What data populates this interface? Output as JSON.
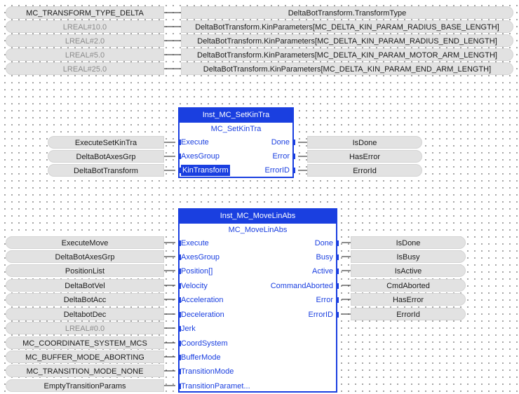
{
  "header_rows": [
    {
      "left": "MC_TRANSFORM_TYPE_DELTA",
      "right": "DeltaBotTransform.TransformType",
      "dim": false
    },
    {
      "left": "LREAL#10.0",
      "right": "DeltaBotTransform.KinParameters[MC_DELTA_KIN_PARAM_RADIUS_BASE_LENGTH]",
      "dim": true
    },
    {
      "left": "LREAL#2.0",
      "right": "DeltaBotTransform.KinParameters[MC_DELTA_KIN_PARAM_RADIUS_END_LENGTH]",
      "dim": true
    },
    {
      "left": "LREAL#5.0",
      "right": "DeltaBotTransform.KinParameters[MC_DELTA_KIN_PARAM_MOTOR_ARM_LENGTH]",
      "dim": true
    },
    {
      "left": "LREAL#25.0",
      "right": "DeltaBotTransform.KinParameters[MC_DELTA_KIN_PARAM_END_ARM_LENGTH]",
      "dim": true
    }
  ],
  "setkin": {
    "instance": "Inst_MC_SetKinTra",
    "type": "MC_SetKinTra",
    "inputs": [
      {
        "pin": "Execute",
        "var": "ExecuteSetKinTra",
        "selected": false
      },
      {
        "pin": "AxesGroup",
        "var": "DeltaBotAxesGrp",
        "selected": false
      },
      {
        "pin": "KinTransform",
        "var": "DeltaBotTransform",
        "selected": true
      }
    ],
    "outputs": [
      {
        "pin": "Done",
        "var": "IsDone"
      },
      {
        "pin": "Error",
        "var": "HasError"
      },
      {
        "pin": "ErrorID",
        "var": "ErrorId"
      }
    ]
  },
  "movelin": {
    "instance": "Inst_MC_MoveLinAbs",
    "type": "MC_MoveLinAbs",
    "inputs": [
      {
        "pin": "Execute",
        "var": "ExecuteMove",
        "dim": false
      },
      {
        "pin": "AxesGroup",
        "var": "DeltaBotAxesGrp",
        "dim": false
      },
      {
        "pin": "Position[]",
        "var": "PositionList",
        "dim": false
      },
      {
        "pin": "Velocity",
        "var": "DeltaBotVel",
        "dim": false
      },
      {
        "pin": "Acceleration",
        "var": "DeltaBotAcc",
        "dim": false
      },
      {
        "pin": "Deceleration",
        "var": "DeltabotDec",
        "dim": false
      },
      {
        "pin": "Jerk",
        "var": "LREAL#0.0",
        "dim": true
      },
      {
        "pin": "CoordSystem",
        "var": "MC_COORDINATE_SYSTEM_MCS",
        "dim": false
      },
      {
        "pin": "BufferMode",
        "var": "MC_BUFFER_MODE_ABORTING",
        "dim": false
      },
      {
        "pin": "TransitionMode",
        "var": "MC_TRANSITION_MODE_NONE",
        "dim": false
      },
      {
        "pin": "TransitionParamet...",
        "var": "EmptyTransitionParams",
        "dim": false
      }
    ],
    "outputs": [
      {
        "pin": "Done",
        "var": "IsDone"
      },
      {
        "pin": "Busy",
        "var": "IsBusy"
      },
      {
        "pin": "Active",
        "var": "IsActive"
      },
      {
        "pin": "CommandAborted",
        "var": "CmdAborted"
      },
      {
        "pin": "Error",
        "var": "HasError"
      },
      {
        "pin": "ErrorID",
        "var": "ErrorId"
      }
    ]
  },
  "colors": {
    "fb_blue": "#1a3fe0",
    "pill_bg": "#e2e2e2"
  }
}
